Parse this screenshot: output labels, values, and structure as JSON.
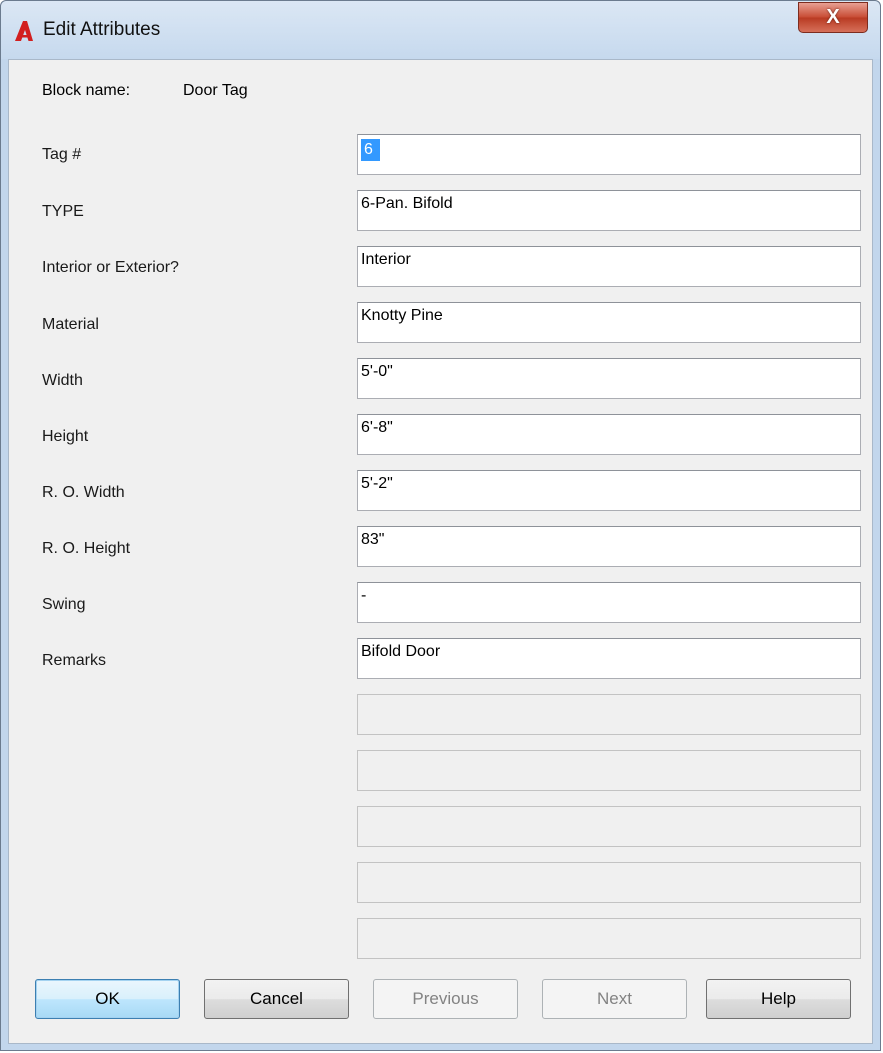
{
  "window": {
    "title": "Edit Attributes",
    "close_glyph": "X"
  },
  "block": {
    "label": "Block name:",
    "value": "Door Tag"
  },
  "attributes": [
    {
      "label": "Tag #",
      "value": "6"
    },
    {
      "label": "TYPE",
      "value": "6-Pan. Bifold"
    },
    {
      "label": "Interior or Exterior?",
      "value": "Interior"
    },
    {
      "label": "Material",
      "value": "Knotty Pine"
    },
    {
      "label": "Width",
      "value": "5'-0\""
    },
    {
      "label": "Height",
      "value": "6'-8\""
    },
    {
      "label": "R. O. Width",
      "value": "5'-2\""
    },
    {
      "label": "R. O. Height",
      "value": "83\""
    },
    {
      "label": "Swing",
      "value": "-"
    },
    {
      "label": "Remarks",
      "value": "Bifold Door"
    }
  ],
  "empty_field_count": 5,
  "buttons": {
    "ok": "OK",
    "cancel": "Cancel",
    "previous": "Previous",
    "next": "Next",
    "help": "Help"
  },
  "colors": {
    "selection": "#3399ff",
    "close_button": "#c74a32",
    "app_icon": "#d21f1f"
  }
}
